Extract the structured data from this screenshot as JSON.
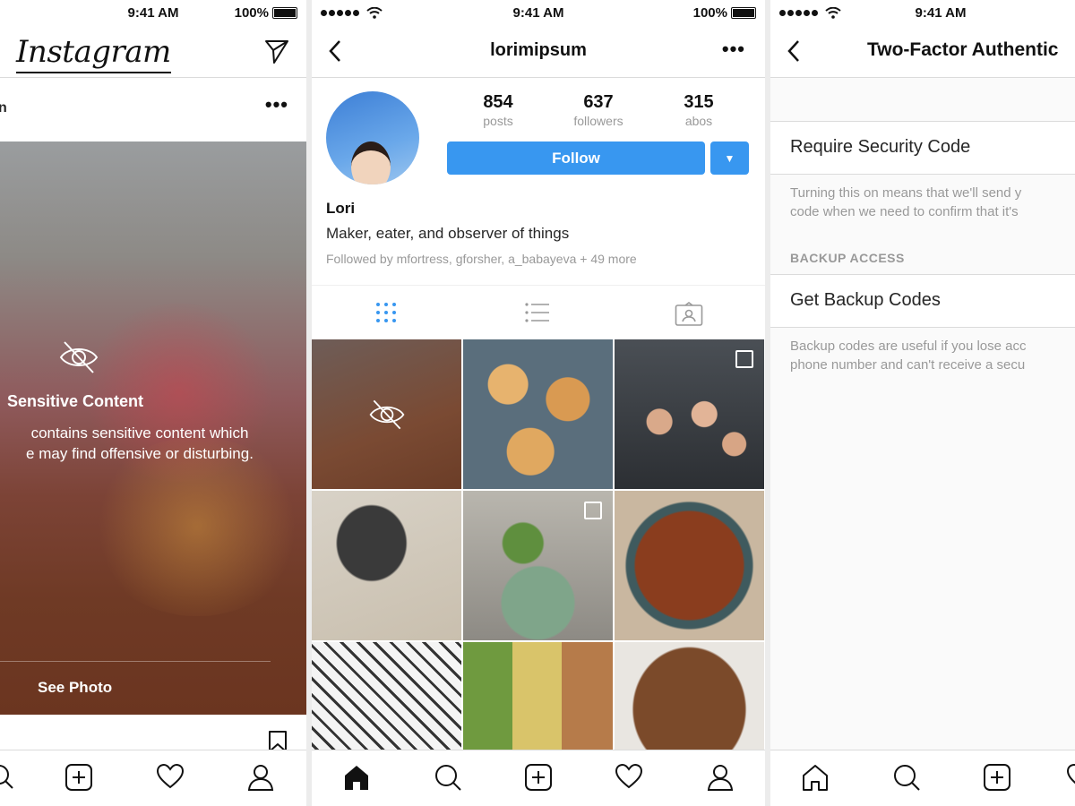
{
  "status": {
    "time": "9:41 AM",
    "battery": "100%"
  },
  "feed": {
    "logo": "Instagram",
    "username": "n",
    "more": "•••",
    "sensitive": {
      "title": "Sensitive Content",
      "line1": "contains sensitive content which",
      "line2": "e may find offensive or disturbing.",
      "action": "See Photo"
    }
  },
  "profile": {
    "username": "lorimipsum",
    "more": "•••",
    "stats": [
      {
        "num": "854",
        "label": "posts"
      },
      {
        "num": "637",
        "label": "followers"
      },
      {
        "num": "315",
        "label": "abos"
      }
    ],
    "follow_label": "Follow",
    "dropdown_glyph": "▼",
    "name": "Lori",
    "bio": "Maker, eater, and observer of things",
    "followed_by": "Followed by mfortress, gforsher, a_babayeva + 49 more"
  },
  "twofactor": {
    "title": "Two-Factor Authentic",
    "require_label": "Require Security Code",
    "require_note_1": "Turning this on means that we'll send y",
    "require_note_2": "code when we need to confirm that it's",
    "section_backup": "BACKUP ACCESS",
    "backup_label": "Get Backup Codes",
    "backup_note_1": "Backup codes are useful if you lose acc",
    "backup_note_2": "phone number and can't receive a secu"
  },
  "colors": {
    "accent": "#3897f0",
    "border": "#dbdbdb",
    "muted": "#999999"
  }
}
